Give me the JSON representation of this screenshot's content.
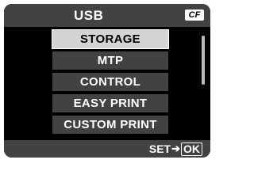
{
  "header": {
    "title": "USB",
    "card_badge": "CF"
  },
  "menu": {
    "items": [
      {
        "label": "STORAGE",
        "selected": true
      },
      {
        "label": "MTP",
        "selected": false
      },
      {
        "label": "CONTROL",
        "selected": false
      },
      {
        "label": "EASY PRINT",
        "selected": false
      },
      {
        "label": "CUSTOM PRINT",
        "selected": false
      }
    ]
  },
  "footer": {
    "set_label": "SET",
    "arrow": "➔",
    "ok_label": "OK"
  },
  "colors": {
    "background": "#000000",
    "bar": "#424242",
    "selected": "#d4d4d4",
    "text": "#ffffff"
  }
}
